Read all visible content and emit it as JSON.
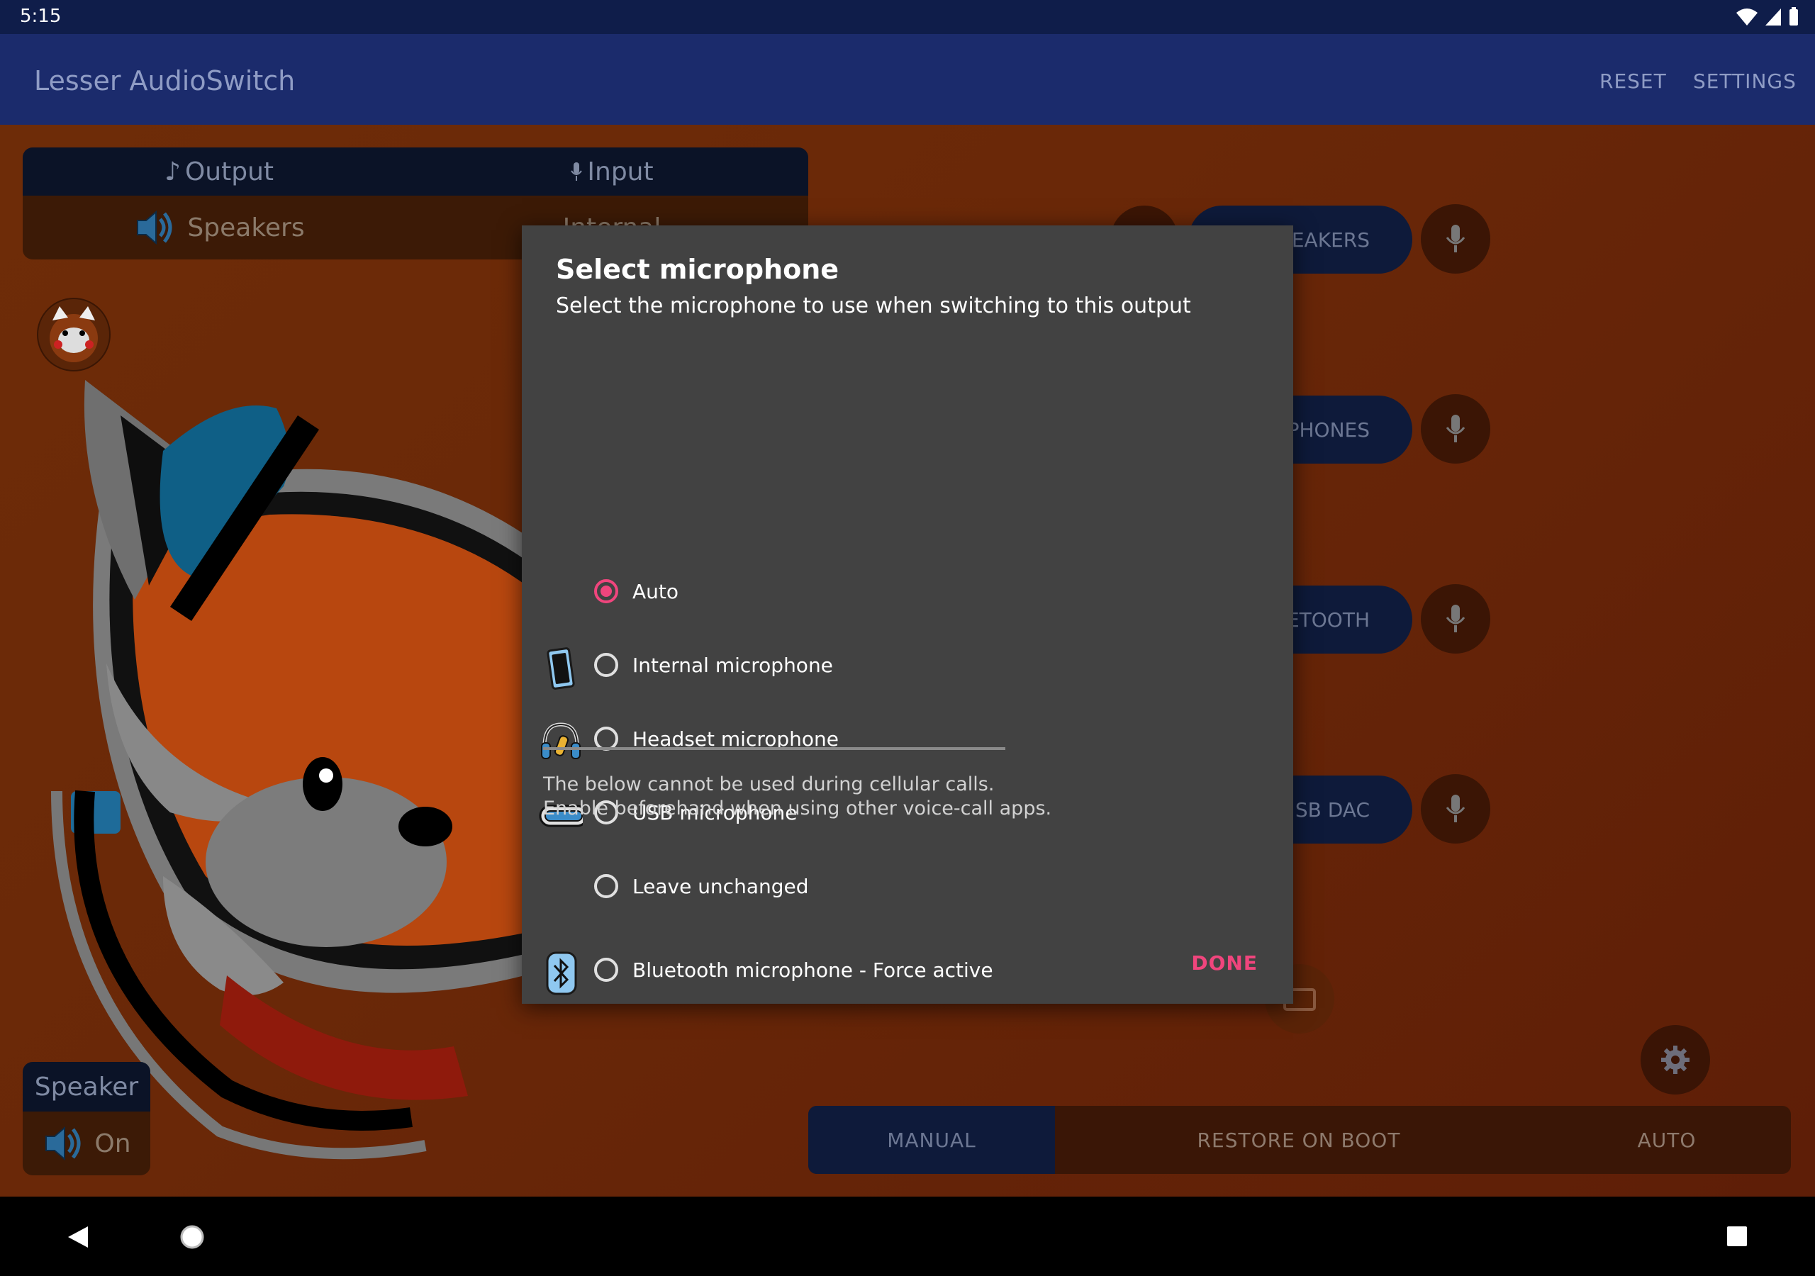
{
  "status_bar": {
    "time": "5:15"
  },
  "app_bar": {
    "title": "Lesser AudioSwitch",
    "actions": {
      "reset": "RESET",
      "settings": "SETTINGS"
    }
  },
  "io_card": {
    "output_label": "Output",
    "input_label": "Input",
    "output_value": "Speakers",
    "input_value": "Internal"
  },
  "device_buttons": [
    {
      "label": "PEAKERS"
    },
    {
      "label": "ADPHONES"
    },
    {
      "label": "UETOOTH"
    },
    {
      "label": "SB DAC"
    }
  ],
  "speaker_card": {
    "title": "Speaker",
    "value": "On"
  },
  "mode_bar": {
    "manual": "MANUAL",
    "restore": "RESTORE ON BOOT",
    "auto": "AUTO"
  },
  "dialog": {
    "title": "Select microphone",
    "subtitle": "Select the microphone to use when switching to this output",
    "options": [
      {
        "label": "Auto",
        "selected": true,
        "icon": "none"
      },
      {
        "label": "Internal microphone",
        "selected": false,
        "icon": "phone-icon"
      },
      {
        "label": "Headset microphone",
        "selected": false,
        "icon": "headset-icon"
      },
      {
        "label": "USB microphone",
        "selected": false,
        "icon": "usb-c-icon"
      },
      {
        "label": "Leave unchanged",
        "selected": false,
        "icon": "none"
      }
    ],
    "note_line1": "The below cannot be used during cellular calls.",
    "note_line2": "Enable beforehand when using other voice-call apps.",
    "bluetooth_option": {
      "label": "Bluetooth microphone - Force active",
      "selected": false,
      "icon": "bluetooth-icon"
    },
    "done": "DONE"
  },
  "colors": {
    "accent": "#f0457d",
    "app_bar": "#1b2b6c",
    "dialog_bg": "#424242",
    "background": "#6e2c08"
  }
}
